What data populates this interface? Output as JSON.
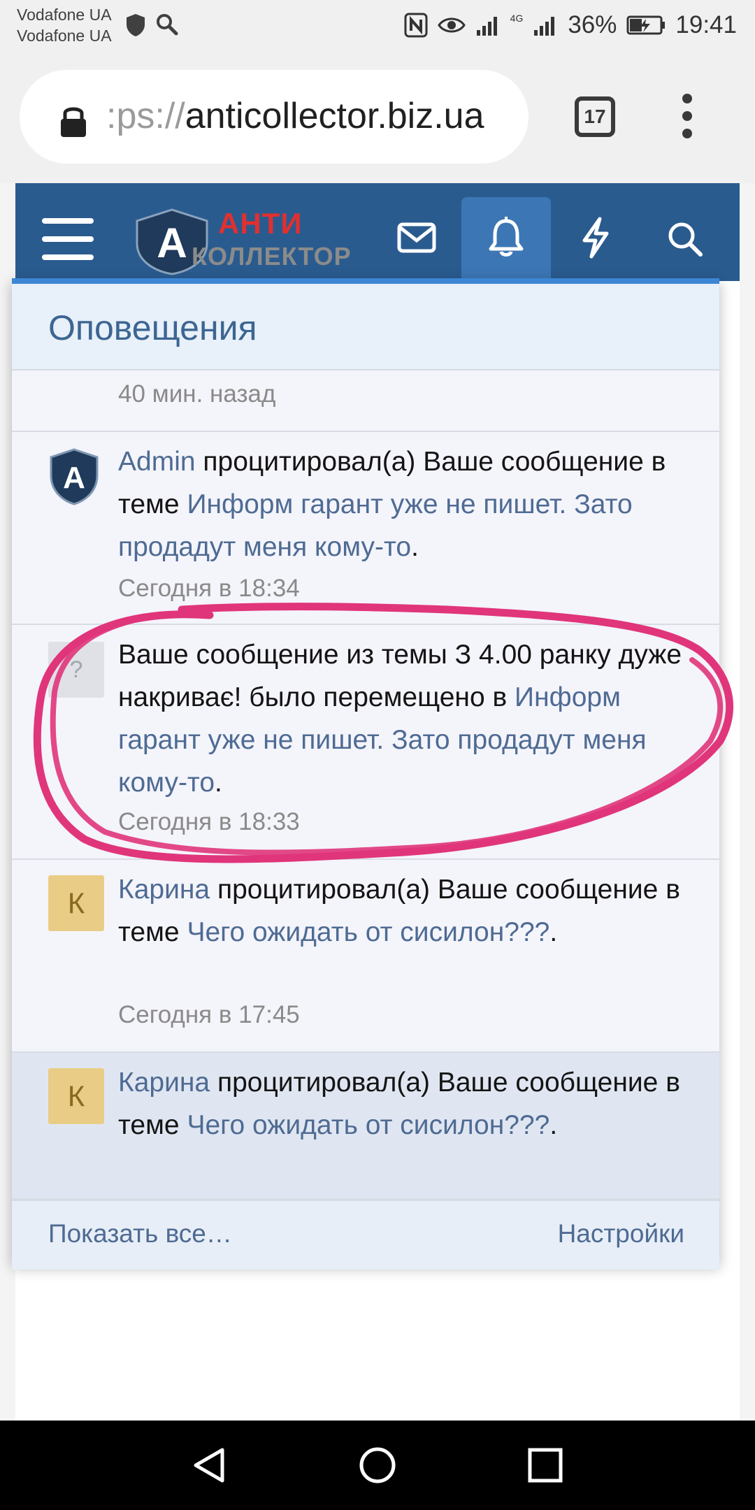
{
  "status_bar": {
    "carrier1": "Vodafone UA",
    "carrier2": "Vodafone UA",
    "network": "4G",
    "battery": "36%",
    "time": "19:41"
  },
  "browser": {
    "url_prefix": ":ps://",
    "url_host": "anticollector.biz.ua",
    "tab_count": "17"
  },
  "site": {
    "logo_top": "АНТИ",
    "logo_bottom": "КОЛЛЕКТОР",
    "logo_letter": "A"
  },
  "popup": {
    "title": "Оповещения",
    "notifications": [
      {
        "time": "40 мин. назад"
      },
      {
        "avatar_letter": "A",
        "user": "Admin",
        "action": " процитировал(а) Ваше сообщение в теме ",
        "thread": "Информ гарант уже не пишет. Зато продадут меня кому-то",
        "end": ".",
        "time": "Сегодня в 18:34"
      },
      {
        "avatar_letter": "?",
        "text": "Ваше сообщение из темы З 4.00 ранку дуже накриває! было перемещено в ",
        "thread": "Информ гарант уже не пишет. Зато продадут меня кому-то",
        "end": ".",
        "time": "Сегодня в 18:33"
      },
      {
        "avatar_letter": "К",
        "user": "Карина",
        "action": " процитировал(а) Ваше сообщение в теме ",
        "thread": "Чего ожидать от сисилон???",
        "end": ".",
        "time": "Сегодня в 17:45"
      },
      {
        "avatar_letter": "К",
        "user": "Карина",
        "action": " процитировал(а) Ваше сообщение в теме ",
        "thread": "Чего ожидать от сисилон???",
        "end": "."
      }
    ],
    "show_all": "Показать все…",
    "settings": "Настройки"
  },
  "colors": {
    "header_blue": "#2a5b8f",
    "link": "#4e6b93",
    "annotation": "#e0357a"
  }
}
